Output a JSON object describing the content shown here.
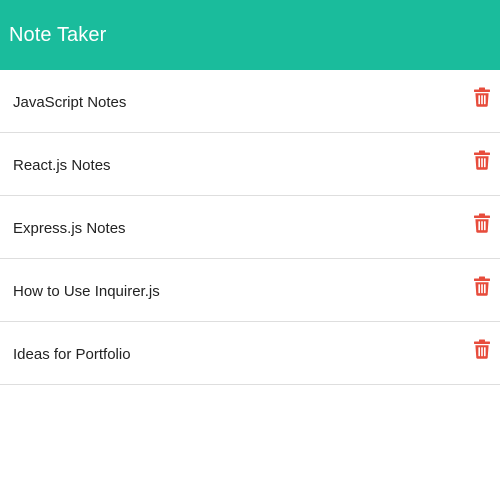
{
  "navbar": {
    "title": "Note Taker"
  },
  "notes": [
    {
      "title": "JavaScript Notes",
      "delete_icon": "trash-icon"
    },
    {
      "title": "React.js Notes",
      "delete_icon": "trash-icon"
    },
    {
      "title": "Express.js Notes",
      "delete_icon": "trash-icon"
    },
    {
      "title": "How to Use Inquirer.js",
      "delete_icon": "trash-icon"
    },
    {
      "title": "Ideas for Portfolio",
      "delete_icon": "trash-icon"
    }
  ],
  "colors": {
    "navbar_background": "#1abc9c",
    "navbar_text": "#ffffff",
    "delete_icon": "#e74c3c",
    "divider": "#dedede"
  }
}
